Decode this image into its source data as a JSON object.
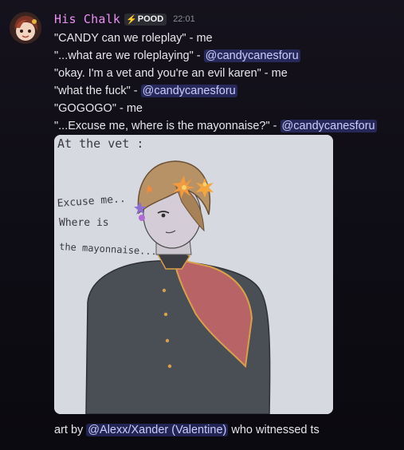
{
  "message": {
    "author": "His Chalk",
    "role_icon": "lightning-bolt-icon",
    "role_tag": "POOD",
    "timestamp": "22:01",
    "lines": [
      {
        "text": "\"CANDY can we roleplay\" - me",
        "mention": ""
      },
      {
        "text": "\"...what are we roleplaying\" - ",
        "mention": "@candycanesforu"
      },
      {
        "text": "\"okay. I'm a vet and you're an evil karen\" - me",
        "mention": ""
      },
      {
        "text": "\"what the fuck\" - ",
        "mention": "@candycanesforu"
      },
      {
        "text": "\"GOGOGO\" - me",
        "mention": ""
      },
      {
        "text": "\"...Excuse me, where is the mayonnaise?\" - ",
        "mention": "@candycanesforu"
      }
    ],
    "attachment": {
      "caption_top": "At the vet :",
      "caption_left": [
        "Excuse me..",
        "Where is",
        "the mayonnaise..."
      ]
    },
    "footer": {
      "prefix": "art by ",
      "mention": "@Alexx/Xander (Valentine)",
      "suffix": " who witnessed ts"
    }
  },
  "colors": {
    "username": "#ec8ff2",
    "mention_bg": "rgba(88,101,242,0.30)",
    "mention_text": "#c9cdfb",
    "background": "#120f18",
    "role_bolt": "#f5c000"
  }
}
